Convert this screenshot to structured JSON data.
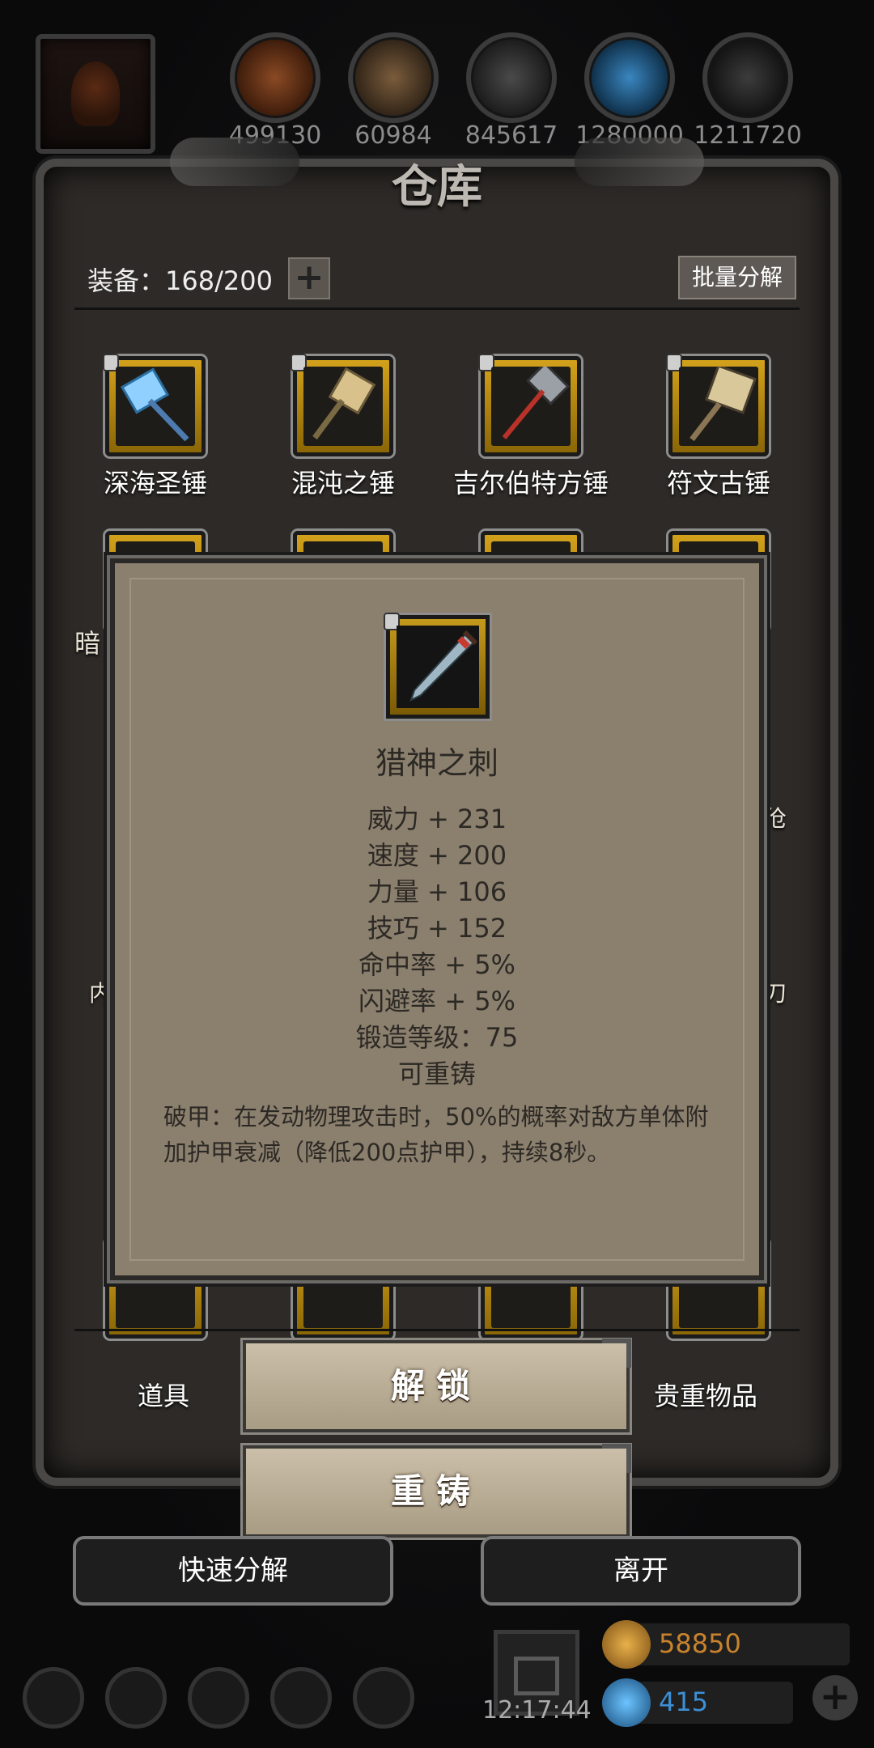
{
  "resources": [
    {
      "value": "499130",
      "icon": "bread-icon",
      "color": "#7a4020"
    },
    {
      "value": "60984",
      "icon": "wood-icon",
      "color": "#6b5034"
    },
    {
      "value": "845617",
      "icon": "iron-ingot-icon",
      "color": "#3c3c3c"
    },
    {
      "value": "1280000",
      "icon": "crystal-icon",
      "color": "#2a6c9c"
    },
    {
      "value": "1211720",
      "icon": "ore-icon",
      "color": "#2c2c2c"
    }
  ],
  "warehouse": {
    "title": "仓库",
    "equip_count": "装备：168/200",
    "add_label": "+",
    "batch_label": "批量分解"
  },
  "items": [
    {
      "name": "深海圣锤",
      "icon": "blue-hammer-icon",
      "locked": true
    },
    {
      "name": "混沌之锤",
      "icon": "chaos-hammer-icon",
      "locked": true
    },
    {
      "name": "吉尔伯特方锤",
      "icon": "red-hammer-icon",
      "locked": true
    },
    {
      "name": "符文古锤",
      "icon": "rune-hammer-icon",
      "locked": true
    }
  ],
  "partial_labels": [
    "暗",
    "伧",
    "内",
    "刀"
  ],
  "tooltip": {
    "name": "猎神之刺",
    "icon": "dagger-icon",
    "stats": [
      "威力 + 231",
      "速度 + 200",
      "力量 + 106",
      "技巧 + 152",
      "命中率 + 5%",
      "闪避率 + 5%",
      "锻造等级：75",
      "可重铸"
    ],
    "description": "破甲：在发动物理攻击时，50%的概率对敌方单体附加护甲衰减（降低200点护甲），持续8秒。"
  },
  "tabs": {
    "left": "道具",
    "right": "贵重物品"
  },
  "actions": {
    "unlock": "解锁",
    "reforge": "重铸"
  },
  "footer_buttons": {
    "quick": "快速分解",
    "leave": "离开"
  },
  "hud": {
    "clock": "12:17:44",
    "gold": "58850",
    "gems": "415",
    "gold_color": "#c9832c",
    "gem_color": "#3d8fd6"
  }
}
